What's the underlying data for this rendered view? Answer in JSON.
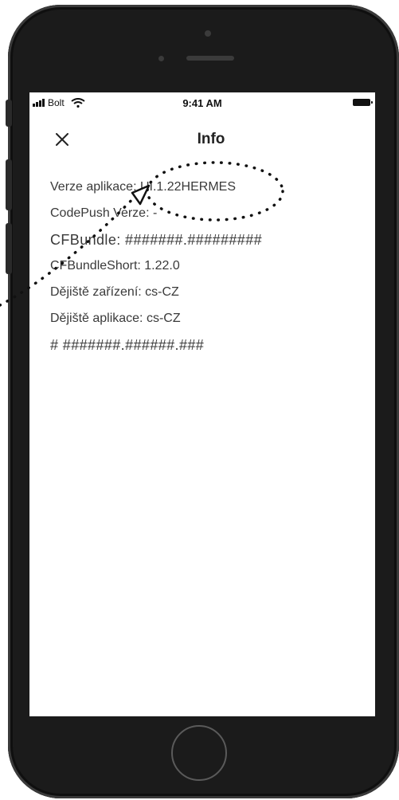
{
  "status_bar": {
    "carrier": "Bolt",
    "time": "9:41 AM",
    "icons": [
      "signal-icon",
      "wifi-icon",
      "battery-icon"
    ]
  },
  "nav": {
    "title": "Info",
    "close_icon": "close-icon"
  },
  "info": {
    "app_version": "Verze aplikace: UI.1.22HERMES",
    "codepush_version": "CodePush Verze: -",
    "cf_bundle": "CFBundle: #######.#########",
    "cf_bundle_short": "CFBundleShort: 1.22.0",
    "device_locale": "Dějiště zařízení: cs-CZ",
    "app_locale": "Dějiště aplikace: cs-CZ",
    "hash_line": "# #######.######.###"
  },
  "colors": {
    "phone_body": "#1b1b1b",
    "screen_bg": "#ffffff",
    "text": "#3a3a3a",
    "title": "#222222"
  }
}
